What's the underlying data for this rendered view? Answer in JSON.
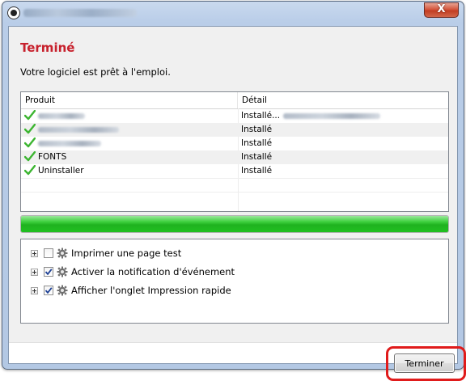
{
  "window": {
    "close_label": "X"
  },
  "page": {
    "heading": "Terminé",
    "subtitle": "Votre logiciel est prêt à l'emploi."
  },
  "product_list": {
    "columns": [
      "Produit",
      "Détail"
    ],
    "rows": [
      {
        "product": "",
        "detail": "Installé..."
      },
      {
        "product": "",
        "detail": "Installé"
      },
      {
        "product": "",
        "detail": "Installé"
      },
      {
        "product": "FONTS",
        "detail": "Installé"
      },
      {
        "product": "Uninstaller",
        "detail": "Installé"
      }
    ]
  },
  "progress": {
    "value": 1.0
  },
  "options": [
    {
      "label": "Imprimer une page test",
      "checked": false
    },
    {
      "label": "Activer la notification d'événement",
      "checked": true
    },
    {
      "label": "Afficher l'onglet Impression rapide",
      "checked": true
    }
  ],
  "footer": {
    "finish_label": "Terminer"
  },
  "colors": {
    "heading": "#c7212d",
    "progress": "#1fb21f",
    "check": "#3cb531",
    "highlight": "#e01b1b"
  },
  "icons": {
    "app": "app-icon",
    "close": "close-icon",
    "check": "green-check-icon",
    "option": "gear-icon"
  }
}
